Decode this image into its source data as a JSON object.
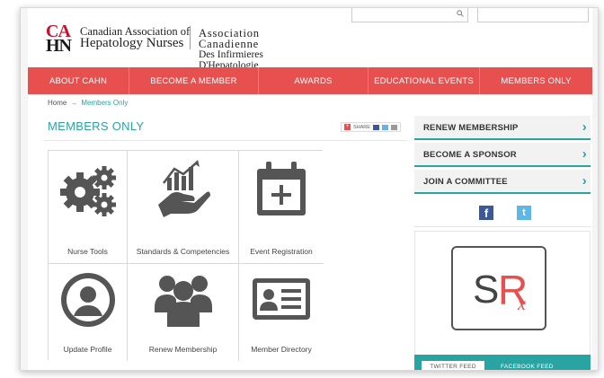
{
  "header": {
    "logo_mark_top": "CA",
    "logo_mark_bottom": "HN",
    "org_en_line1": "Canadian Association of",
    "org_en_line2": "Hepatology Nurses",
    "org_fr_line1": "Association Canadienne",
    "org_fr_line2": "Des Infirmieres D'Hepatologie",
    "search_icon": "search-icon"
  },
  "nav": {
    "items": [
      {
        "label": "ABOUT CAHN"
      },
      {
        "label": "BECOME A MEMBER"
      },
      {
        "label": "AWARDS"
      },
      {
        "label": "EDUCATIONAL EVENTS"
      },
      {
        "label": "MEMBERS ONLY"
      }
    ]
  },
  "breadcrumb": {
    "home": "Home",
    "separator": "→",
    "current": "Members Only"
  },
  "main": {
    "title": "MEMBERS ONLY",
    "share_label": "SHARE",
    "tiles": [
      {
        "label": "Nurse Tools",
        "icon": "gears-icon"
      },
      {
        "label": "Standards & Competencies",
        "icon": "hand-chart-icon"
      },
      {
        "label": "Event Registration",
        "icon": "calendar-plus-icon"
      },
      {
        "label": "Update Profile",
        "icon": "user-circle-icon"
      },
      {
        "label": "Renew Membership",
        "icon": "group-icon"
      },
      {
        "label": "Member Directory",
        "icon": "id-card-icon"
      }
    ]
  },
  "sidebar": {
    "buttons": [
      {
        "label": "RENEW MEMBERSHIP"
      },
      {
        "label": "BECOME A SPONSOR"
      },
      {
        "label": "JOIN A COMMITTEE"
      }
    ],
    "chevron": "›",
    "facebook_glyph": "f",
    "twitter_glyph": "t",
    "sponsor_logo": {
      "s": "S",
      "r": "R",
      "x": "x"
    },
    "feed_tabs": [
      "TWITTER FEED",
      "FACEBOOK FEED"
    ]
  },
  "colors": {
    "nav_red": "#e84f4f",
    "accent_teal": "#2aa3a3",
    "icon_gray": "#555555"
  }
}
